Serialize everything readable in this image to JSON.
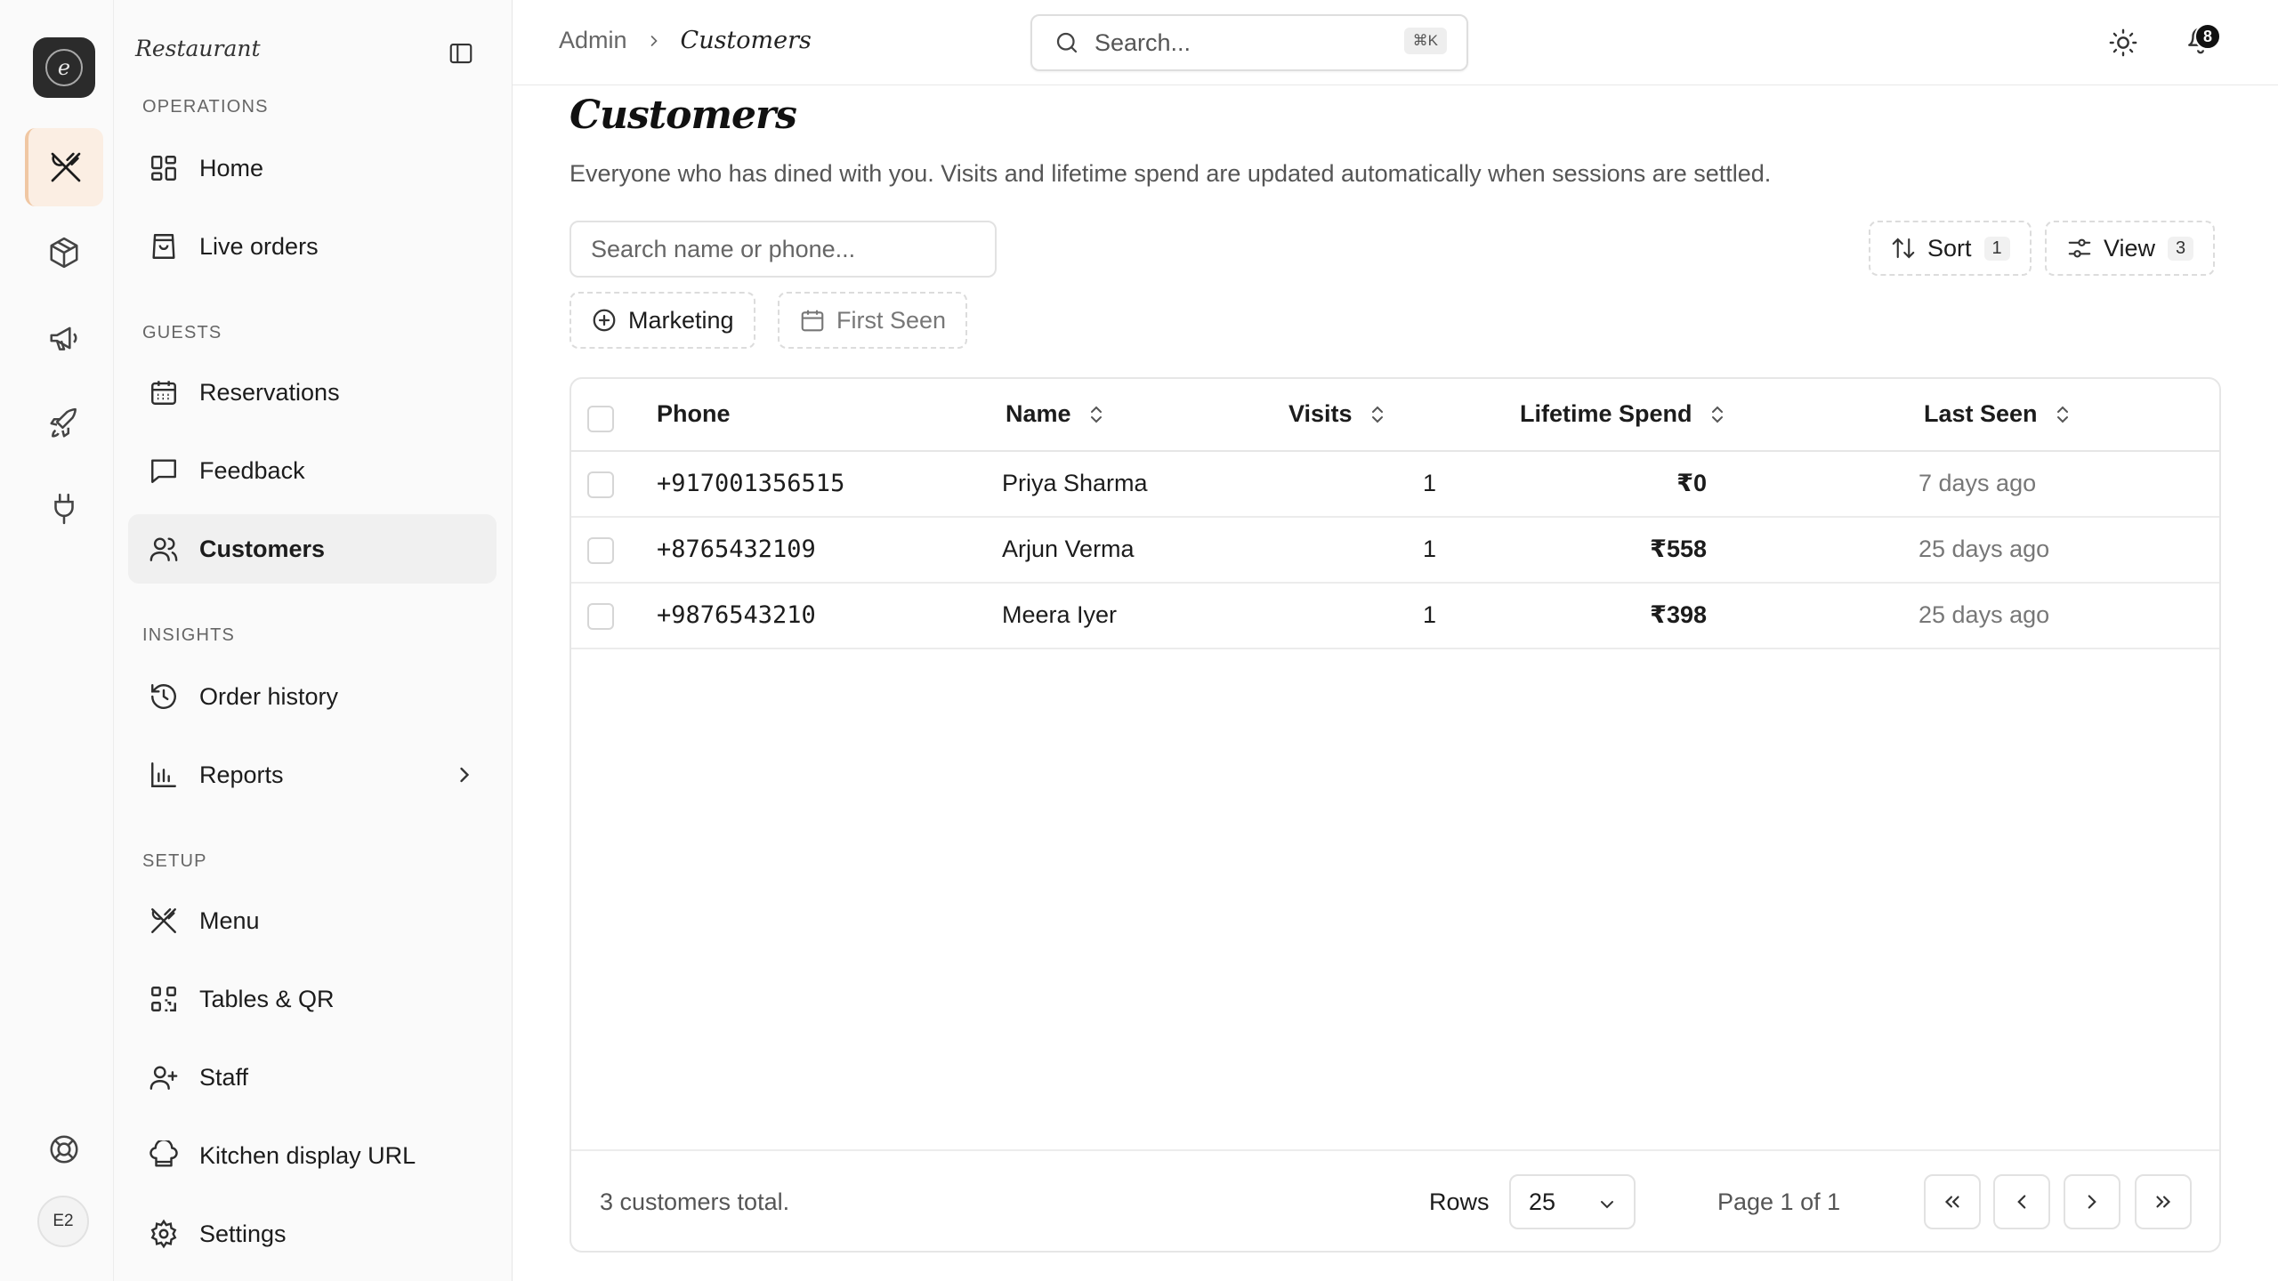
{
  "rail": {
    "logo_letter": "e",
    "avatar_initials": "E2",
    "items": [
      {
        "icon": "utensils-icon"
      },
      {
        "icon": "box-icon"
      },
      {
        "icon": "megaphone-icon"
      },
      {
        "icon": "rocket-icon"
      },
      {
        "icon": "plug-icon"
      },
      {
        "icon": "lifebuoy-icon"
      }
    ]
  },
  "sidebar": {
    "brand": "Restaurant",
    "sections": {
      "operations": "OPERATIONS",
      "guests": "GUESTS",
      "insights": "INSIGHTS",
      "setup": "SETUP"
    },
    "items": {
      "home": "Home",
      "live_orders": "Live orders",
      "reservations": "Reservations",
      "feedback": "Feedback",
      "customers": "Customers",
      "order_history": "Order history",
      "reports": "Reports",
      "menu": "Menu",
      "tables_qr": "Tables & QR",
      "staff": "Staff",
      "kitchen_display": "Kitchen display URL",
      "settings": "Settings"
    },
    "active_item": "customers"
  },
  "header": {
    "breadcrumb_root": "Admin",
    "breadcrumb_current": "Customers",
    "search_placeholder": "Search...",
    "search_shortcut": "⌘K",
    "notification_count": "8"
  },
  "main": {
    "title": "Customers",
    "description": "Everyone who has dined with you. Visits and lifetime spend are updated automatically when sessions are settled.",
    "filter_placeholder": "Search name or phone...",
    "chips": {
      "marketing": "Marketing",
      "first_seen": "First Seen"
    },
    "sort": {
      "label": "Sort",
      "count": "1"
    },
    "view": {
      "label": "View",
      "count": "3"
    },
    "table": {
      "columns": {
        "phone": "Phone",
        "name": "Name",
        "visits": "Visits",
        "lifetime_spend": "Lifetime Spend",
        "last_seen": "Last Seen"
      },
      "rows": [
        {
          "phone": "+917001356515",
          "name": "Priya Sharma",
          "visits": "1",
          "spend": "₹0",
          "last_seen": "7 days ago"
        },
        {
          "phone": "+8765432109",
          "name": "Arjun Verma",
          "visits": "1",
          "spend": "₹558",
          "last_seen": "25 days ago"
        },
        {
          "phone": "+9876543210",
          "name": "Meera Iyer",
          "visits": "1",
          "spend": "₹398",
          "last_seen": "25 days ago"
        }
      ]
    },
    "footer": {
      "total": "3 customers total.",
      "rows_label": "Rows",
      "rows_value": "25",
      "page_info": "Page 1 of 1"
    }
  },
  "colors": {
    "accent_bg": "#fbeee3",
    "accent_border": "#f0c7a3",
    "active_nav_bg": "#f0f0f0"
  }
}
